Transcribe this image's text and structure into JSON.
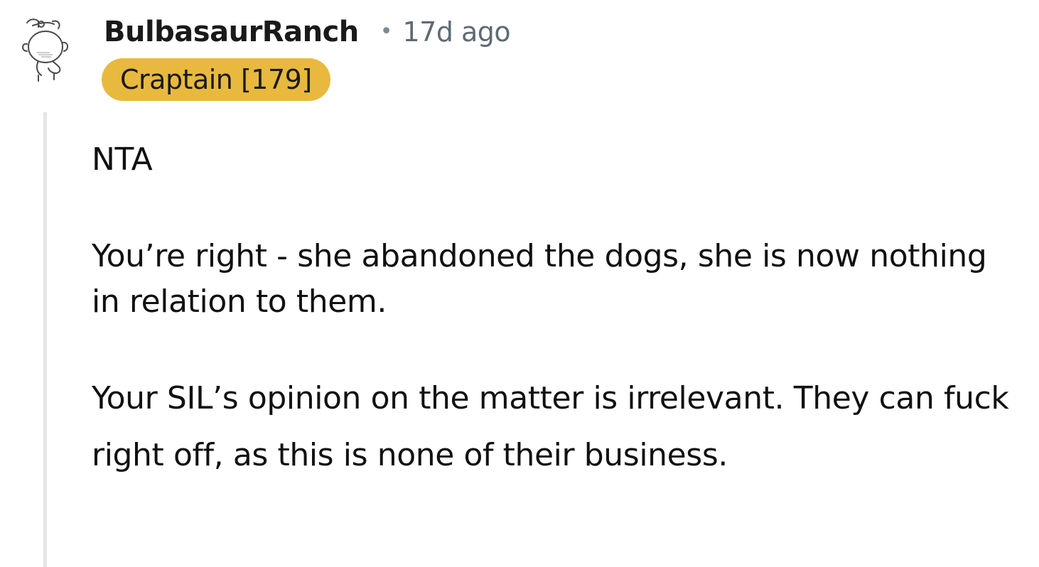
{
  "comment": {
    "author": "BulbasaurRanch",
    "separator": "•",
    "timestamp": "17d ago",
    "flair": "Craptain [179]",
    "paragraphs": [
      "NTA",
      "You’re right - she abandoned the dogs, she is now nothing in relation to them.",
      "Your SIL’s opinion on the matter is irrelevant. They can fuck right off, as this is none of their business."
    ]
  },
  "icons": {
    "avatar": "snoo-avatar-icon"
  },
  "colors": {
    "flair_bg": "#e8b93e",
    "thread_line": "#e4e6e8",
    "meta_text": "#5f6b73"
  }
}
